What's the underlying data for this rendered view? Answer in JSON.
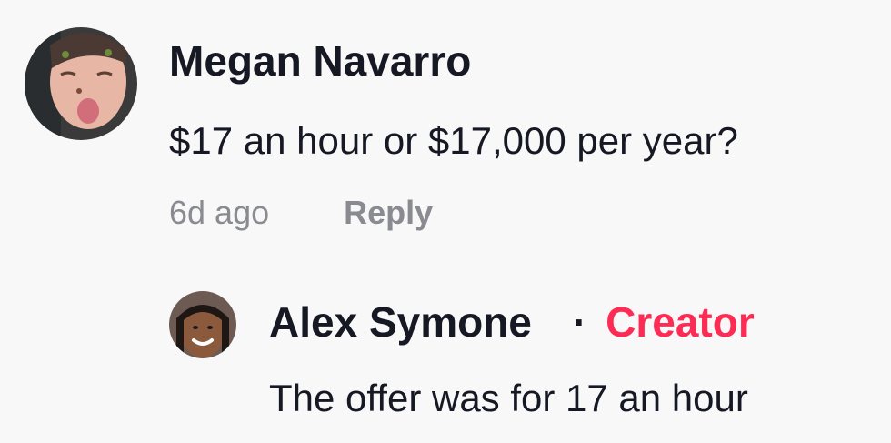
{
  "comments": [
    {
      "author": "Megan Navarro",
      "text": "$17 an hour or $17,000 per year?",
      "time": "6d ago",
      "reply_label": "Reply",
      "avatar_icon": "user-avatar-photo"
    }
  ],
  "replies": [
    {
      "author": "Alex Symone",
      "separator": "·",
      "badge": "Creator",
      "text": "The offer was for 17 an hour",
      "avatar_icon": "creator-avatar-photo"
    }
  ],
  "colors": {
    "background": "#f8f8f8",
    "text": "#161823",
    "muted": "#8a8b91",
    "creator_badge": "#fe2c55"
  }
}
